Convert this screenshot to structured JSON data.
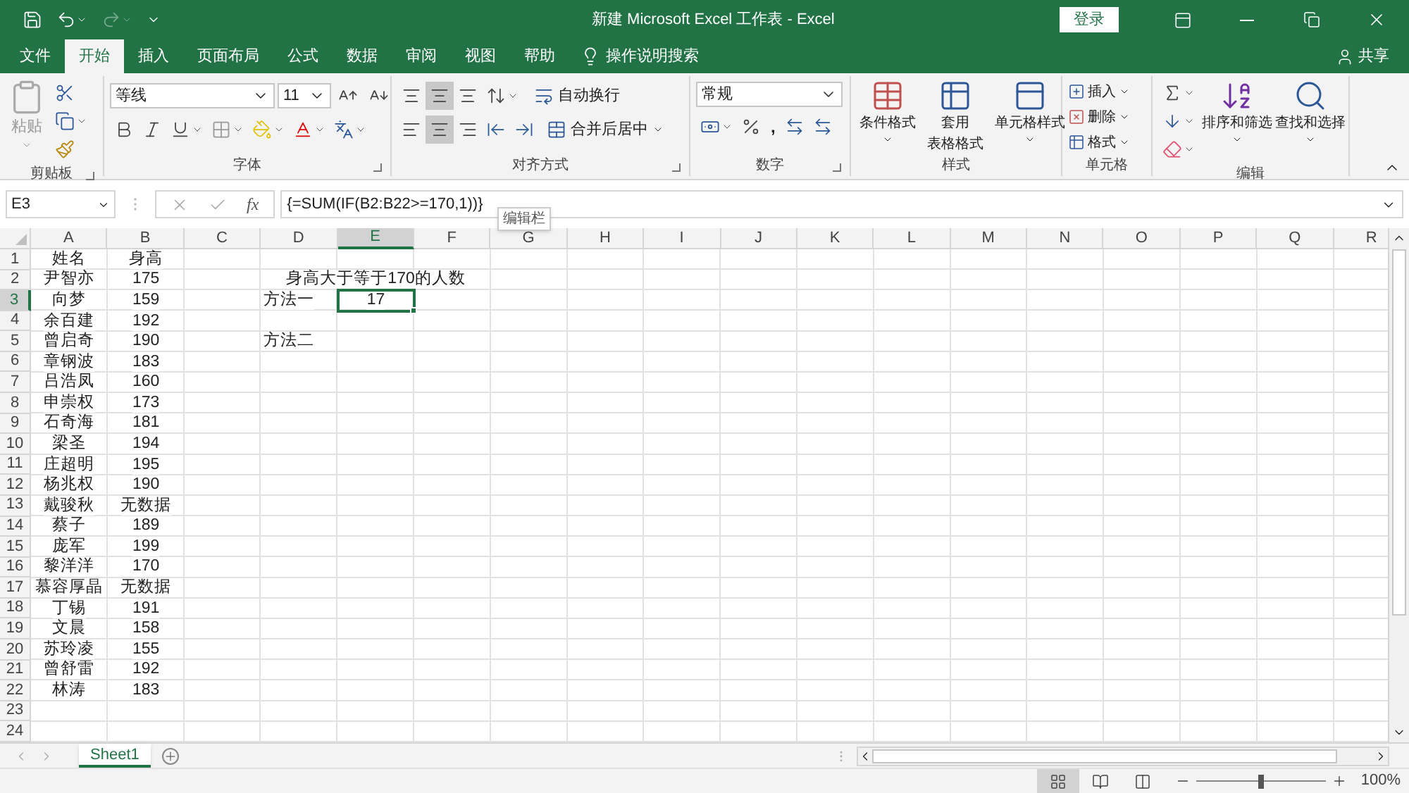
{
  "title_bar": {
    "title": "新建 Microsoft Excel 工作表 - Excel",
    "sign_in": "登录"
  },
  "tabs": [
    {
      "label": "文件",
      "selected": false
    },
    {
      "label": "开始",
      "selected": true
    },
    {
      "label": "插入",
      "selected": false
    },
    {
      "label": "页面布局",
      "selected": false
    },
    {
      "label": "公式",
      "selected": false
    },
    {
      "label": "数据",
      "selected": false
    },
    {
      "label": "审阅",
      "selected": false
    },
    {
      "label": "视图",
      "selected": false
    },
    {
      "label": "帮助",
      "selected": false
    }
  ],
  "tell_me": "操作说明搜索",
  "share": "共享",
  "ribbon": {
    "clipboard": {
      "paste": "粘贴",
      "label": "剪贴板"
    },
    "font": {
      "name": "等线",
      "size": "11",
      "label": "字体"
    },
    "alignment": {
      "wrap": "自动换行",
      "merge": "合并后居中",
      "label": "对齐方式"
    },
    "number": {
      "format": "常规",
      "comma": ",",
      "label": "数字"
    },
    "styles": {
      "conditional": "条件格式",
      "table_format": [
        "套用",
        "表格格式"
      ],
      "cell_styles": "单元格样式",
      "label": "样式"
    },
    "cells": {
      "insert": "插入",
      "delete": "删除",
      "format": "格式",
      "label": "单元格"
    },
    "editing": {
      "sort": "排序和筛选",
      "find": "查找和选择",
      "label": "编辑"
    }
  },
  "formula_bar": {
    "name_box": "E3",
    "fx": "fx",
    "formula": "{=SUM(IF(B2:B22>=170,1))}",
    "tooltip": "编辑栏"
  },
  "columns": [
    {
      "label": "A",
      "selected": false
    },
    {
      "label": "B",
      "selected": false
    },
    {
      "label": "C",
      "selected": false
    },
    {
      "label": "D",
      "selected": false
    },
    {
      "label": "E",
      "selected": true
    },
    {
      "label": "F",
      "selected": false
    },
    {
      "label": "G",
      "selected": false
    },
    {
      "label": "H",
      "selected": false
    },
    {
      "label": "I",
      "selected": false
    },
    {
      "label": "J",
      "selected": false
    },
    {
      "label": "K",
      "selected": false
    },
    {
      "label": "L",
      "selected": false
    },
    {
      "label": "M",
      "selected": false
    },
    {
      "label": "N",
      "selected": false
    },
    {
      "label": "O",
      "selected": false
    },
    {
      "label": "P",
      "selected": false
    },
    {
      "label": "Q",
      "selected": false
    },
    {
      "label": "R",
      "selected": false
    }
  ],
  "rows": [
    {
      "label": "1",
      "selected": false,
      "cells": {
        "A": {
          "text": "姓名",
          "centered": true
        },
        "B": {
          "text": "身高",
          "centered": true
        }
      }
    },
    {
      "label": "2",
      "selected": false,
      "cells": {
        "A": {
          "text": "尹智亦",
          "centered": true
        },
        "B": {
          "text": "175",
          "centered": true
        },
        "E": {
          "text": "身高大于等于170的人数",
          "centered": true
        }
      }
    },
    {
      "label": "3",
      "selected": true,
      "cells": {
        "A": {
          "text": "向梦",
          "centered": true
        },
        "B": {
          "text": "159",
          "centered": true
        },
        "D": {
          "text": "方法一",
          "centered": false
        },
        "E": {
          "text": "17",
          "centered": true
        }
      }
    },
    {
      "label": "4",
      "selected": false,
      "cells": {
        "A": {
          "text": "余百建",
          "centered": true
        },
        "B": {
          "text": "192",
          "centered": true
        }
      }
    },
    {
      "label": "5",
      "selected": false,
      "cells": {
        "A": {
          "text": "曾启奇",
          "centered": true
        },
        "B": {
          "text": "190",
          "centered": true
        },
        "D": {
          "text": "方法二",
          "centered": false
        }
      }
    },
    {
      "label": "6",
      "selected": false,
      "cells": {
        "A": {
          "text": "章钢波",
          "centered": true
        },
        "B": {
          "text": "183",
          "centered": true
        }
      }
    },
    {
      "label": "7",
      "selected": false,
      "cells": {
        "A": {
          "text": "吕浩凤",
          "centered": true
        },
        "B": {
          "text": "160",
          "centered": true
        }
      }
    },
    {
      "label": "8",
      "selected": false,
      "cells": {
        "A": {
          "text": "申崇权",
          "centered": true
        },
        "B": {
          "text": "173",
          "centered": true
        }
      }
    },
    {
      "label": "9",
      "selected": false,
      "cells": {
        "A": {
          "text": "石奇海",
          "centered": true
        },
        "B": {
          "text": "181",
          "centered": true
        }
      }
    },
    {
      "label": "10",
      "selected": false,
      "cells": {
        "A": {
          "text": "梁圣",
          "centered": true
        },
        "B": {
          "text": "194",
          "centered": true
        }
      }
    },
    {
      "label": "11",
      "selected": false,
      "cells": {
        "A": {
          "text": "庄超明",
          "centered": true
        },
        "B": {
          "text": "195",
          "centered": true
        }
      }
    },
    {
      "label": "12",
      "selected": false,
      "cells": {
        "A": {
          "text": "杨兆权",
          "centered": true
        },
        "B": {
          "text": "190",
          "centered": true
        }
      }
    },
    {
      "label": "13",
      "selected": false,
      "cells": {
        "A": {
          "text": "戴骏秋",
          "centered": true
        },
        "B": {
          "text": "无数据",
          "centered": true
        }
      }
    },
    {
      "label": "14",
      "selected": false,
      "cells": {
        "A": {
          "text": "蔡子",
          "centered": true
        },
        "B": {
          "text": "189",
          "centered": true
        }
      }
    },
    {
      "label": "15",
      "selected": false,
      "cells": {
        "A": {
          "text": "庞军",
          "centered": true
        },
        "B": {
          "text": "199",
          "centered": true
        }
      }
    },
    {
      "label": "16",
      "selected": false,
      "cells": {
        "A": {
          "text": "黎洋洋",
          "centered": true
        },
        "B": {
          "text": "170",
          "centered": true
        }
      }
    },
    {
      "label": "17",
      "selected": false,
      "cells": {
        "A": {
          "text": "慕容厚晶",
          "centered": true
        },
        "B": {
          "text": "无数据",
          "centered": true
        }
      }
    },
    {
      "label": "18",
      "selected": false,
      "cells": {
        "A": {
          "text": "丁锡",
          "centered": true
        },
        "B": {
          "text": "191",
          "centered": true
        }
      }
    },
    {
      "label": "19",
      "selected": false,
      "cells": {
        "A": {
          "text": "文晨",
          "centered": true
        },
        "B": {
          "text": "158",
          "centered": true
        }
      }
    },
    {
      "label": "20",
      "selected": false,
      "cells": {
        "A": {
          "text": "苏玲凌",
          "centered": true
        },
        "B": {
          "text": "155",
          "centered": true
        }
      }
    },
    {
      "label": "21",
      "selected": false,
      "cells": {
        "A": {
          "text": "曾舒雷",
          "centered": true
        },
        "B": {
          "text": "192",
          "centered": true
        }
      }
    },
    {
      "label": "22",
      "selected": false,
      "cells": {
        "A": {
          "text": "林涛",
          "centered": true
        },
        "B": {
          "text": "183",
          "centered": true
        }
      }
    },
    {
      "label": "23",
      "selected": false,
      "cells": {}
    },
    {
      "label": "24",
      "selected": false,
      "cells": {}
    }
  ],
  "sheets": [
    {
      "label": "Sheet1",
      "selected": true
    }
  ],
  "status_bar": {
    "views": [
      {
        "kind": "normal",
        "selected": true
      },
      {
        "kind": "page_layout",
        "selected": false
      },
      {
        "kind": "page_break",
        "selected": false
      }
    ],
    "zoom": {
      "level": 0.5,
      "reading": "100%"
    }
  }
}
